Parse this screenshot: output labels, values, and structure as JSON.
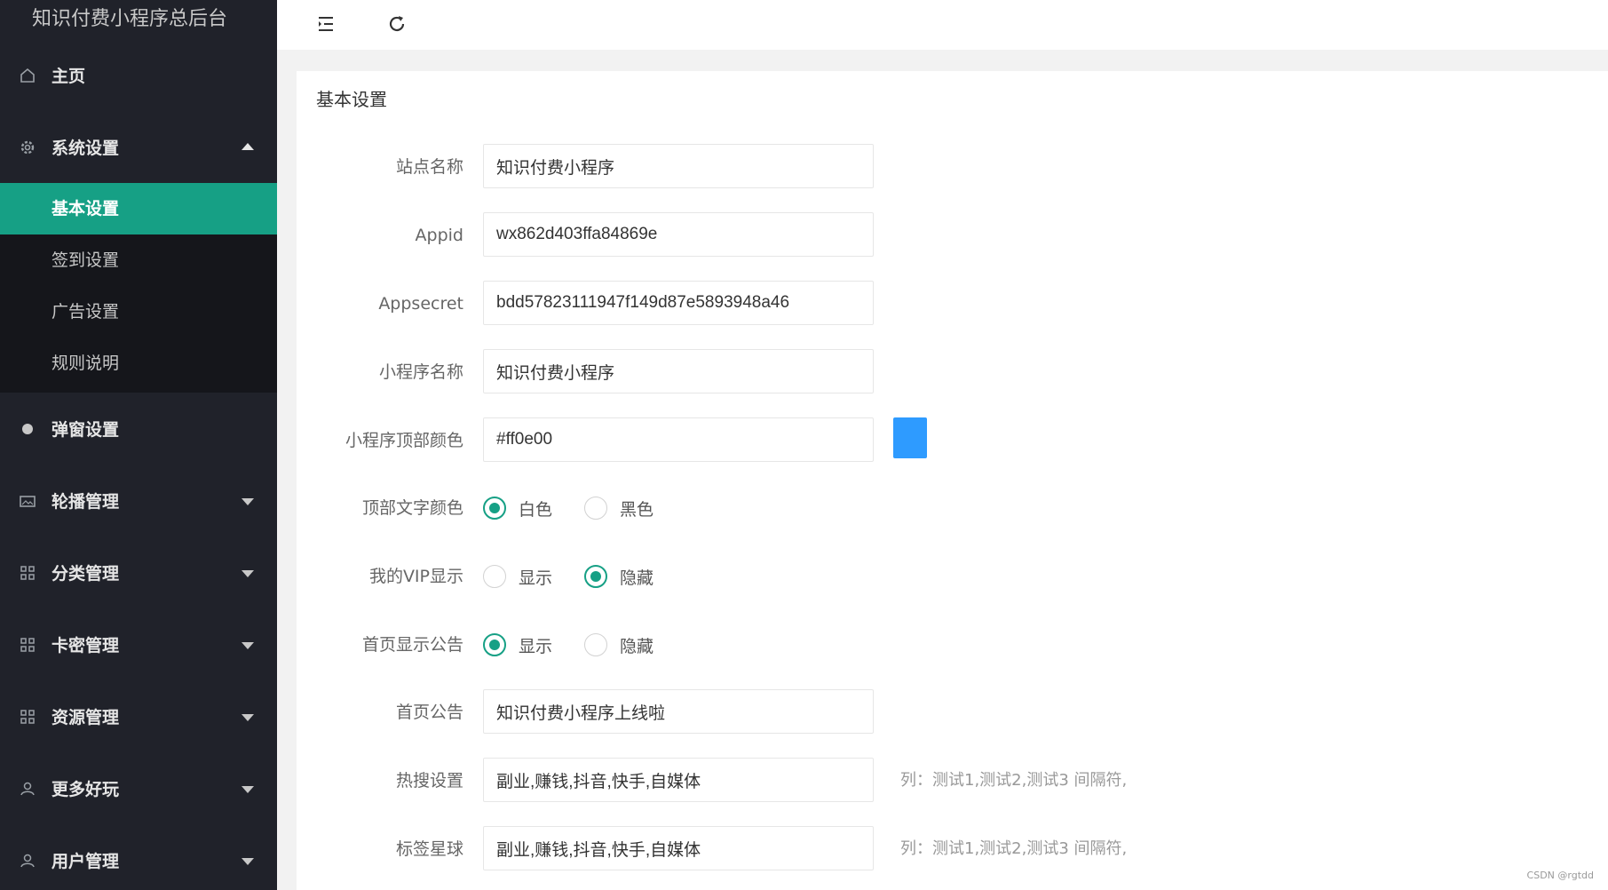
{
  "sidebar": {
    "brand": "知识付费小程序总后台",
    "items": [
      {
        "label": "主页",
        "icon": "home-icon"
      },
      {
        "label": "系统设置",
        "icon": "gear-icon",
        "expanded": true,
        "children": [
          {
            "label": "基本设置",
            "active": true
          },
          {
            "label": "签到设置"
          },
          {
            "label": "广告设置"
          },
          {
            "label": "规则说明"
          }
        ]
      },
      {
        "label": "弹窗设置",
        "icon": "dot-icon"
      },
      {
        "label": "轮播管理",
        "icon": "image-icon"
      },
      {
        "label": "分类管理",
        "icon": "grid-icon"
      },
      {
        "label": "卡密管理",
        "icon": "grid-icon"
      },
      {
        "label": "资源管理",
        "icon": "grid-icon"
      },
      {
        "label": "更多好玩",
        "icon": "user-icon"
      },
      {
        "label": "用户管理",
        "icon": "user-icon"
      }
    ]
  },
  "header": {
    "menu_icon": "menu-fold-icon",
    "refresh_icon": "refresh-icon"
  },
  "main": {
    "title": "基本设置",
    "form": {
      "site_name": {
        "label": "站点名称",
        "value": "知识付费小程序"
      },
      "appid": {
        "label": "Appid",
        "value": "wx862d403ffa84869e"
      },
      "appsecret": {
        "label": "Appsecret",
        "value": "bdd57823111947f149d87e5893948a46"
      },
      "mini_name": {
        "label": "小程序名称",
        "value": "知识付费小程序"
      },
      "top_bg_color": {
        "label": "小程序顶部颜色",
        "value": "#ff0e00",
        "color": "#2e9bff"
      },
      "top_text_color": {
        "label": "顶部文字颜色",
        "options": [
          "白色",
          "黑色"
        ],
        "selected": 0
      },
      "vip_display": {
        "label": "我的VIP显示",
        "options": [
          "显示",
          "隐藏"
        ],
        "selected": 1
      },
      "notice_display": {
        "label": "首页显示公告",
        "options": [
          "显示",
          "隐藏"
        ],
        "selected": 0
      },
      "notice": {
        "label": "首页公告",
        "value": "知识付费小程序上线啦"
      },
      "hot_search": {
        "label": "热搜设置",
        "value": "副业,赚钱,抖音,快手,自媒体",
        "hint": "列：测试1,测试2,测试3 间隔符,"
      },
      "tag_ball": {
        "label": "标签星球",
        "value": "副业,赚钱,抖音,快手,自媒体",
        "hint": "列：测试1,测试2,测试3 间隔符,"
      }
    }
  },
  "watermark": "CSDN @rgtdd",
  "colors": {
    "sidebar_bg": "#20222a",
    "accent": "#16a085",
    "color_picker": "#2e9bff"
  }
}
